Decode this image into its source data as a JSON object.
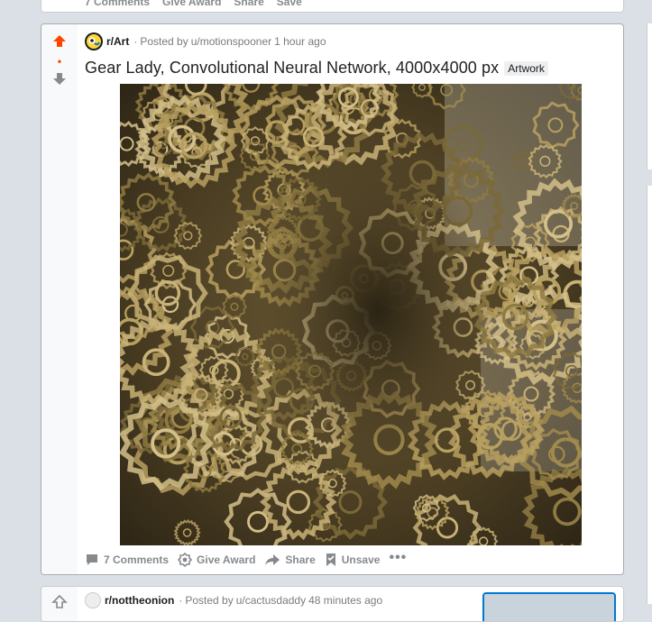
{
  "previous_post": {
    "comments_label": "7 Comments",
    "give_award_label": "Give Award",
    "share_label": "Share",
    "save_label": "Save"
  },
  "post": {
    "vote_score": "•",
    "subreddit": "r/Art",
    "meta_separator": "·",
    "posted_by_prefix": "Posted by",
    "author": "u/motionspooner",
    "time_ago": "1 hour ago",
    "title": "Gear Lady, Convolutional Neural Network, 4000x4000 px",
    "flair": "Artwork",
    "actions": {
      "comments_label": "7 Comments",
      "give_award_label": "Give Award",
      "share_label": "Share",
      "unsave_label": "Unsave",
      "more_label": "•••"
    }
  },
  "next_post": {
    "subreddit": "r/nottheonion",
    "meta_separator": "·",
    "posted_by_prefix": "Posted by",
    "author": "u/cactusdaddy",
    "time_ago": "48 minutes ago"
  },
  "colors": {
    "upvote_active": "#ff4500",
    "background": "#dae0e6",
    "meta_text": "#787c7e",
    "action_text": "#878a8c"
  },
  "icons": {
    "upvote": "arrow-up-icon",
    "downvote": "arrow-down-icon",
    "comments": "comment-bubble-icon",
    "award": "award-icon",
    "share": "share-arrow-icon",
    "unsave": "bookmark-icon",
    "more": "more-dots-icon"
  }
}
